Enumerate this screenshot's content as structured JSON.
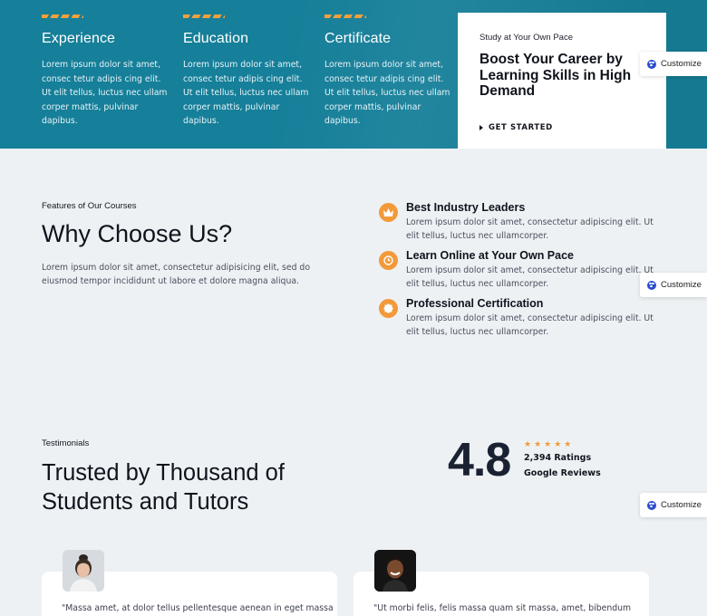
{
  "features": [
    {
      "title": "Experience",
      "text": "Lorem ipsum dolor sit amet, consec tetur adipis cing elit. Ut elit tellus, luctus nec ullam corper mattis, pulvinar dapibus."
    },
    {
      "title": "Education",
      "text": "Lorem ipsum dolor sit amet, consec tetur adipis cing elit. Ut elit tellus, luctus nec ullam corper mattis, pulvinar dapibus."
    },
    {
      "title": "Certificate",
      "text": "Lorem ipsum dolor sit amet, consec tetur adipis cing elit. Ut elit tellus, luctus nec ullam corper mattis, pulvinar dapibus."
    }
  ],
  "cta": {
    "eyebrow": "Study at Your Own Pace",
    "title": "Boost Your Career by Learning Skills in High Demand",
    "button": "GET STARTED"
  },
  "customize_label": "Customize",
  "why": {
    "label": "Features of Our Courses",
    "title": "Why Choose Us?",
    "desc": "Lorem ipsum dolor sit amet, consectetur adipisicing elit, sed do eiusmod tempor incididunt ut labore et dolore magna aliqua.",
    "reasons": [
      {
        "title": "Best Industry Leaders",
        "text": "Lorem ipsum dolor sit amet, consectetur adipiscing elit. Ut elit tellus, luctus nec ullamcorper.",
        "icon": "crown-icon"
      },
      {
        "title": "Learn Online at Your Own Pace",
        "text": "Lorem ipsum dolor sit amet, consectetur adipiscing elit. Ut elit tellus, luctus nec ullamcorper.",
        "icon": "clock-icon"
      },
      {
        "title": "Professional Certification",
        "text": "Lorem ipsum dolor sit amet, consectetur adipiscing elit. Ut elit tellus, luctus nec ullamcorper.",
        "icon": "badge-icon"
      }
    ]
  },
  "testimonials": {
    "label": "Testimonials",
    "title_line1": "Trusted by Thousand of",
    "title_line2": "Students and Tutors",
    "rating": "4.8",
    "stars": "★★★★★",
    "ratings_count": "2,394 Ratings",
    "source": "Google Reviews",
    "cards": [
      {
        "quote": "\"Massa amet, at dolor tellus pellentesque aenean in eget massa"
      },
      {
        "quote": "\"Ut morbi felis, felis massa quam sit massa, amet, bibendum"
      }
    ]
  },
  "colors": {
    "teal": "#167f99",
    "accent": "#f29a3a",
    "background": "#eef1f4"
  }
}
